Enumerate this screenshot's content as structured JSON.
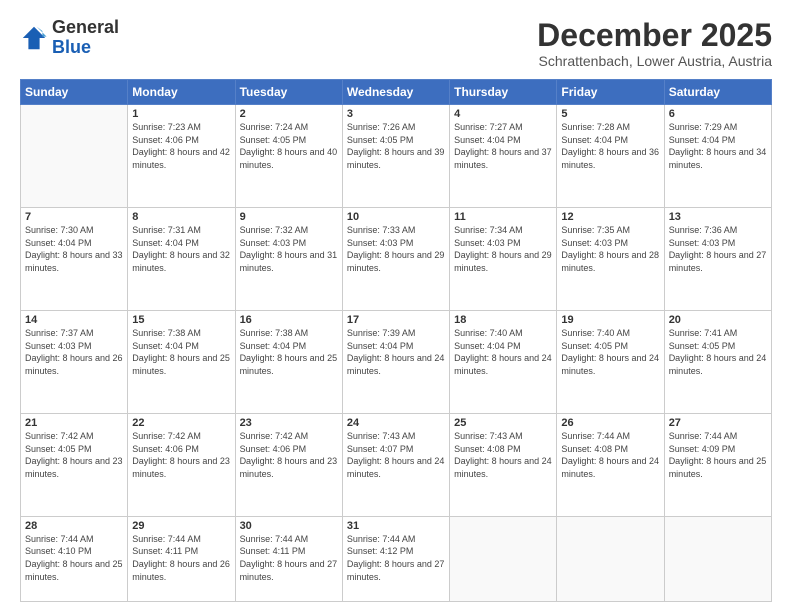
{
  "logo": {
    "general": "General",
    "blue": "Blue"
  },
  "header": {
    "month": "December 2025",
    "location": "Schrattenbach, Lower Austria, Austria"
  },
  "weekdays": [
    "Sunday",
    "Monday",
    "Tuesday",
    "Wednesday",
    "Thursday",
    "Friday",
    "Saturday"
  ],
  "weeks": [
    [
      {
        "day": "",
        "sunrise": "",
        "sunset": "",
        "daylight": ""
      },
      {
        "day": "1",
        "sunrise": "Sunrise: 7:23 AM",
        "sunset": "Sunset: 4:06 PM",
        "daylight": "Daylight: 8 hours and 42 minutes."
      },
      {
        "day": "2",
        "sunrise": "Sunrise: 7:24 AM",
        "sunset": "Sunset: 4:05 PM",
        "daylight": "Daylight: 8 hours and 40 minutes."
      },
      {
        "day": "3",
        "sunrise": "Sunrise: 7:26 AM",
        "sunset": "Sunset: 4:05 PM",
        "daylight": "Daylight: 8 hours and 39 minutes."
      },
      {
        "day": "4",
        "sunrise": "Sunrise: 7:27 AM",
        "sunset": "Sunset: 4:04 PM",
        "daylight": "Daylight: 8 hours and 37 minutes."
      },
      {
        "day": "5",
        "sunrise": "Sunrise: 7:28 AM",
        "sunset": "Sunset: 4:04 PM",
        "daylight": "Daylight: 8 hours and 36 minutes."
      },
      {
        "day": "6",
        "sunrise": "Sunrise: 7:29 AM",
        "sunset": "Sunset: 4:04 PM",
        "daylight": "Daylight: 8 hours and 34 minutes."
      }
    ],
    [
      {
        "day": "7",
        "sunrise": "Sunrise: 7:30 AM",
        "sunset": "Sunset: 4:04 PM",
        "daylight": "Daylight: 8 hours and 33 minutes."
      },
      {
        "day": "8",
        "sunrise": "Sunrise: 7:31 AM",
        "sunset": "Sunset: 4:04 PM",
        "daylight": "Daylight: 8 hours and 32 minutes."
      },
      {
        "day": "9",
        "sunrise": "Sunrise: 7:32 AM",
        "sunset": "Sunset: 4:03 PM",
        "daylight": "Daylight: 8 hours and 31 minutes."
      },
      {
        "day": "10",
        "sunrise": "Sunrise: 7:33 AM",
        "sunset": "Sunset: 4:03 PM",
        "daylight": "Daylight: 8 hours and 29 minutes."
      },
      {
        "day": "11",
        "sunrise": "Sunrise: 7:34 AM",
        "sunset": "Sunset: 4:03 PM",
        "daylight": "Daylight: 8 hours and 29 minutes."
      },
      {
        "day": "12",
        "sunrise": "Sunrise: 7:35 AM",
        "sunset": "Sunset: 4:03 PM",
        "daylight": "Daylight: 8 hours and 28 minutes."
      },
      {
        "day": "13",
        "sunrise": "Sunrise: 7:36 AM",
        "sunset": "Sunset: 4:03 PM",
        "daylight": "Daylight: 8 hours and 27 minutes."
      }
    ],
    [
      {
        "day": "14",
        "sunrise": "Sunrise: 7:37 AM",
        "sunset": "Sunset: 4:03 PM",
        "daylight": "Daylight: 8 hours and 26 minutes."
      },
      {
        "day": "15",
        "sunrise": "Sunrise: 7:38 AM",
        "sunset": "Sunset: 4:04 PM",
        "daylight": "Daylight: 8 hours and 25 minutes."
      },
      {
        "day": "16",
        "sunrise": "Sunrise: 7:38 AM",
        "sunset": "Sunset: 4:04 PM",
        "daylight": "Daylight: 8 hours and 25 minutes."
      },
      {
        "day": "17",
        "sunrise": "Sunrise: 7:39 AM",
        "sunset": "Sunset: 4:04 PM",
        "daylight": "Daylight: 8 hours and 24 minutes."
      },
      {
        "day": "18",
        "sunrise": "Sunrise: 7:40 AM",
        "sunset": "Sunset: 4:04 PM",
        "daylight": "Daylight: 8 hours and 24 minutes."
      },
      {
        "day": "19",
        "sunrise": "Sunrise: 7:40 AM",
        "sunset": "Sunset: 4:05 PM",
        "daylight": "Daylight: 8 hours and 24 minutes."
      },
      {
        "day": "20",
        "sunrise": "Sunrise: 7:41 AM",
        "sunset": "Sunset: 4:05 PM",
        "daylight": "Daylight: 8 hours and 24 minutes."
      }
    ],
    [
      {
        "day": "21",
        "sunrise": "Sunrise: 7:42 AM",
        "sunset": "Sunset: 4:05 PM",
        "daylight": "Daylight: 8 hours and 23 minutes."
      },
      {
        "day": "22",
        "sunrise": "Sunrise: 7:42 AM",
        "sunset": "Sunset: 4:06 PM",
        "daylight": "Daylight: 8 hours and 23 minutes."
      },
      {
        "day": "23",
        "sunrise": "Sunrise: 7:42 AM",
        "sunset": "Sunset: 4:06 PM",
        "daylight": "Daylight: 8 hours and 23 minutes."
      },
      {
        "day": "24",
        "sunrise": "Sunrise: 7:43 AM",
        "sunset": "Sunset: 4:07 PM",
        "daylight": "Daylight: 8 hours and 24 minutes."
      },
      {
        "day": "25",
        "sunrise": "Sunrise: 7:43 AM",
        "sunset": "Sunset: 4:08 PM",
        "daylight": "Daylight: 8 hours and 24 minutes."
      },
      {
        "day": "26",
        "sunrise": "Sunrise: 7:44 AM",
        "sunset": "Sunset: 4:08 PM",
        "daylight": "Daylight: 8 hours and 24 minutes."
      },
      {
        "day": "27",
        "sunrise": "Sunrise: 7:44 AM",
        "sunset": "Sunset: 4:09 PM",
        "daylight": "Daylight: 8 hours and 25 minutes."
      }
    ],
    [
      {
        "day": "28",
        "sunrise": "Sunrise: 7:44 AM",
        "sunset": "Sunset: 4:10 PM",
        "daylight": "Daylight: 8 hours and 25 minutes."
      },
      {
        "day": "29",
        "sunrise": "Sunrise: 7:44 AM",
        "sunset": "Sunset: 4:11 PM",
        "daylight": "Daylight: 8 hours and 26 minutes."
      },
      {
        "day": "30",
        "sunrise": "Sunrise: 7:44 AM",
        "sunset": "Sunset: 4:11 PM",
        "daylight": "Daylight: 8 hours and 27 minutes."
      },
      {
        "day": "31",
        "sunrise": "Sunrise: 7:44 AM",
        "sunset": "Sunset: 4:12 PM",
        "daylight": "Daylight: 8 hours and 27 minutes."
      },
      {
        "day": "",
        "sunrise": "",
        "sunset": "",
        "daylight": ""
      },
      {
        "day": "",
        "sunrise": "",
        "sunset": "",
        "daylight": ""
      },
      {
        "day": "",
        "sunrise": "",
        "sunset": "",
        "daylight": ""
      }
    ]
  ]
}
